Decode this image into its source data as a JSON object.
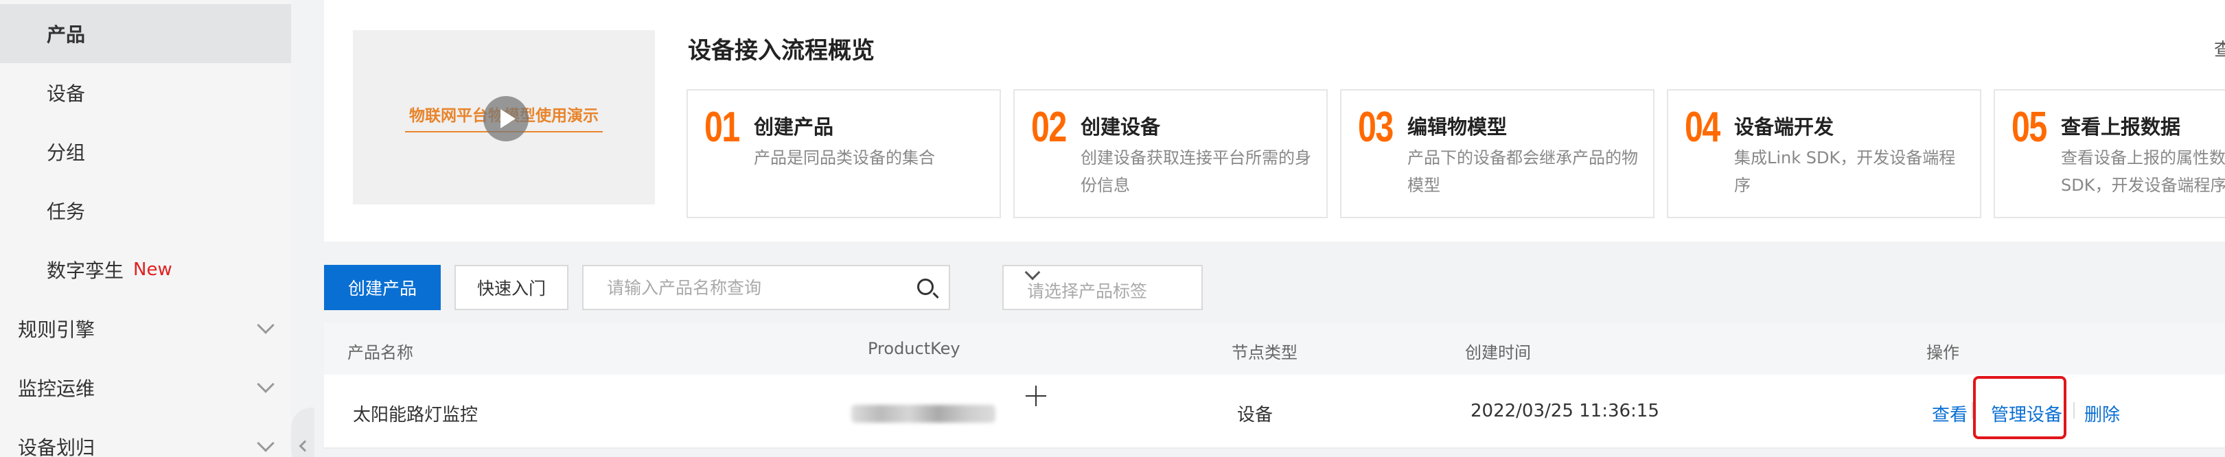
{
  "sidebar": {
    "items": [
      {
        "label": "产品",
        "active": true
      },
      {
        "label": "设备"
      },
      {
        "label": "分组"
      },
      {
        "label": "任务"
      },
      {
        "label": "数字孪生",
        "badge": "New"
      }
    ],
    "groups": [
      {
        "label": "规则引擎"
      },
      {
        "label": "监控运维"
      },
      {
        "label": "设备划归"
      }
    ]
  },
  "overview": {
    "video_title": "物联网平台物模型使用演示",
    "title": "设备接入流程概览",
    "right_cut_text": "查",
    "steps": [
      {
        "num": "01",
        "title": "创建产品",
        "desc": "产品是同品类设备的集合"
      },
      {
        "num": "02",
        "title": "创建设备",
        "desc": "创建设备获取连接平台所需的身份信息"
      },
      {
        "num": "03",
        "title": "编辑物模型",
        "desc": "产品下的设备都会继承产品的物模型"
      },
      {
        "num": "04",
        "title": "设备端开发",
        "desc": "集成Link SDK，开发设备端程序"
      },
      {
        "num": "05",
        "title": "查看上报数据",
        "desc": "查看设备上报的属性数SDK，开发设备端程序"
      }
    ]
  },
  "toolbar": {
    "create_label": "创建产品",
    "quick_label": "快速入门",
    "search_placeholder": "请输入产品名称查询",
    "tag_placeholder": "请选择产品标签"
  },
  "table": {
    "headers": [
      "产品名称",
      "ProductKey",
      "节点类型",
      "创建时间",
      "操作"
    ],
    "rows": [
      {
        "name": "太阳能路灯监控",
        "node_type": "设备",
        "created": "2022/03/25 11:36:15",
        "actions": [
          "查看",
          "管理设备",
          "删除"
        ]
      }
    ]
  },
  "colors": {
    "primary": "#0a6fd3",
    "accent_orange": "#ff6a00",
    "highlight_red": "#e0161b",
    "new_badge": "#e02020"
  }
}
